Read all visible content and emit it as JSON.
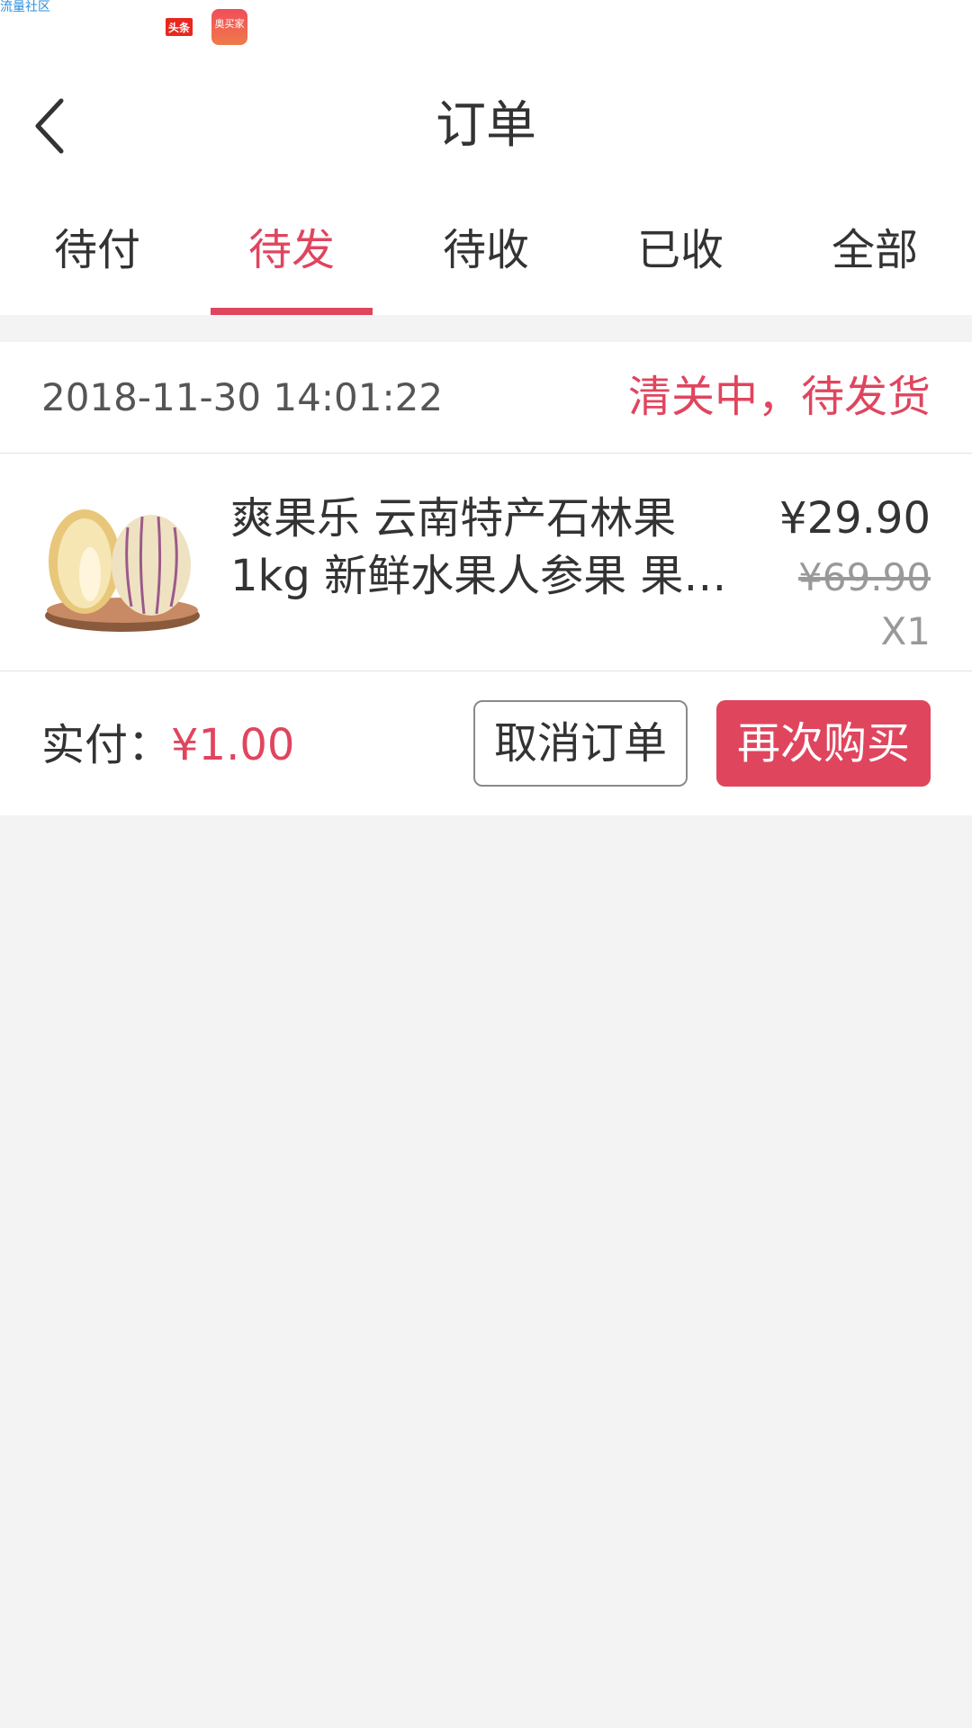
{
  "status_bar": {
    "carrier_text": "流量社区",
    "app_icon_toutiao": "头条",
    "app_icon_store": "奥买家"
  },
  "header": {
    "title": "订单",
    "back_icon": "chevron-left-icon"
  },
  "tabs": [
    {
      "label": "待付",
      "active": false
    },
    {
      "label": "待发",
      "active": true
    },
    {
      "label": "待收",
      "active": false
    },
    {
      "label": "已收",
      "active": false
    },
    {
      "label": "全部",
      "active": false
    }
  ],
  "order": {
    "time": "2018-11-30 14:01:22",
    "status": "清关中，待发货",
    "product": {
      "name": "爽果乐 云南特产石林果1kg 新鲜水果人参果 果…",
      "price": "¥29.90",
      "original_price": "¥69.90",
      "quantity": "X1"
    },
    "paid_label": "实付：",
    "paid_amount": "¥1.00",
    "cancel_label": "取消订单",
    "rebuy_label": "再次购买"
  },
  "colors": {
    "accent": "#e0455e",
    "background": "#f3f3f3"
  }
}
